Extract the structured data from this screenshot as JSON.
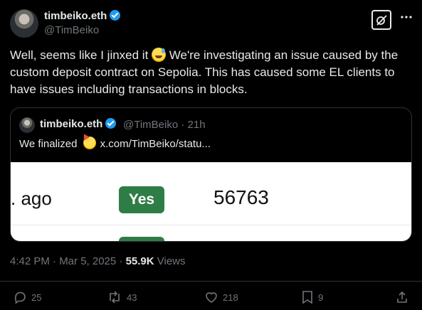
{
  "author": {
    "name": "timbeiko.eth",
    "handle": "@TimBeiko"
  },
  "post": {
    "text_before_emoji": "Well, seems like I jinxed it ",
    "text_after_emoji": " We're investigating an issue caused by the custom deposit contract on Sepolia. This has caused some EL clients to have issues including transactions in blocks."
  },
  "quote": {
    "name": "timbeiko.eth",
    "handle_time": "@TimBeiko · 21h",
    "text_before_emoji": "We finalized ",
    "text_after_emoji": "x.com/TimBeiko/statu...",
    "image": {
      "left_text": ". ago",
      "badge": "Yes",
      "number": "56763"
    }
  },
  "meta": {
    "timestamp": "4:42 PM · Mar 5, 2025 · ",
    "views_count": "55.9K",
    "views_label": " Views"
  },
  "actions": {
    "replies": "25",
    "reposts": "43",
    "likes": "218",
    "bookmarks": "9"
  },
  "icons": [
    "grok-slash-icon",
    "more-icon",
    "reply-icon",
    "repost-icon",
    "like-icon",
    "bookmark-icon",
    "share-icon"
  ],
  "colors": {
    "background": "#000000",
    "text": "#e7e9ea",
    "muted": "#71767b",
    "verified": "#1d9bf0",
    "yes_badge": "#2f7d46"
  }
}
